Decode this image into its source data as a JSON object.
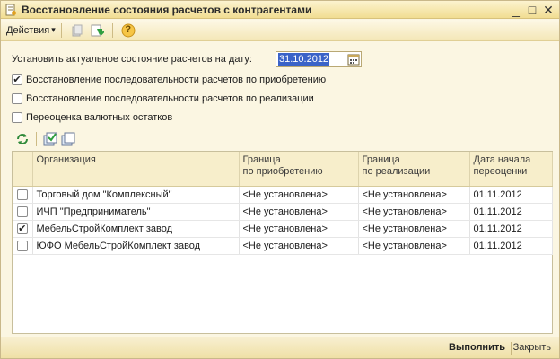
{
  "window": {
    "title": "Восстановление состояния расчетов с контрагентами",
    "minimize": "_",
    "maximize": "□",
    "close": "✕"
  },
  "toolbar": {
    "actions_label": "Действия",
    "actions_arrow": "▾",
    "help_glyph": "?"
  },
  "form": {
    "date_label": "Установить актуальное состояние расчетов на дату:",
    "date_value": "31.10.2012",
    "options": [
      {
        "label": "Восстановление последовательности расчетов по приобретению",
        "checked": true
      },
      {
        "label": "Восстановление последовательности расчетов по реализации",
        "checked": false
      },
      {
        "label": "Переоценка валютных остатков",
        "checked": false
      }
    ]
  },
  "table": {
    "headers": {
      "org": "Организация",
      "purchase_line1": "Граница",
      "purchase_line2": "по приобретению",
      "sale_line1": "Граница",
      "sale_line2": "по реализации",
      "date_line1": "Дата начала",
      "date_line2": "переоценки"
    },
    "rows": [
      {
        "checked": false,
        "org": "Торговый дом \"Комплексный\"",
        "purchase": "<Не установлена>",
        "sale": "<Не установлена>",
        "date": "01.11.2012"
      },
      {
        "checked": false,
        "org": "ИЧП \"Предприниматель\"",
        "purchase": "<Не установлена>",
        "sale": "<Не установлена>",
        "date": "01.11.2012"
      },
      {
        "checked": true,
        "org": "МебельСтройКомплект завод",
        "purchase": "<Не установлена>",
        "sale": "<Не установлена>",
        "date": "01.11.2012"
      },
      {
        "checked": false,
        "org": "ЮФО МебельСтройКомплект завод",
        "purchase": "<Не установлена>",
        "sale": "<Не установлена>",
        "date": "01.11.2012"
      }
    ]
  },
  "footer": {
    "run_label": "Выполнить",
    "close_label": "Закрыть"
  },
  "colors": {
    "window_bg": "#fbf6e2",
    "title_bg": "#f1dd92",
    "selection": "#3a63c8"
  }
}
